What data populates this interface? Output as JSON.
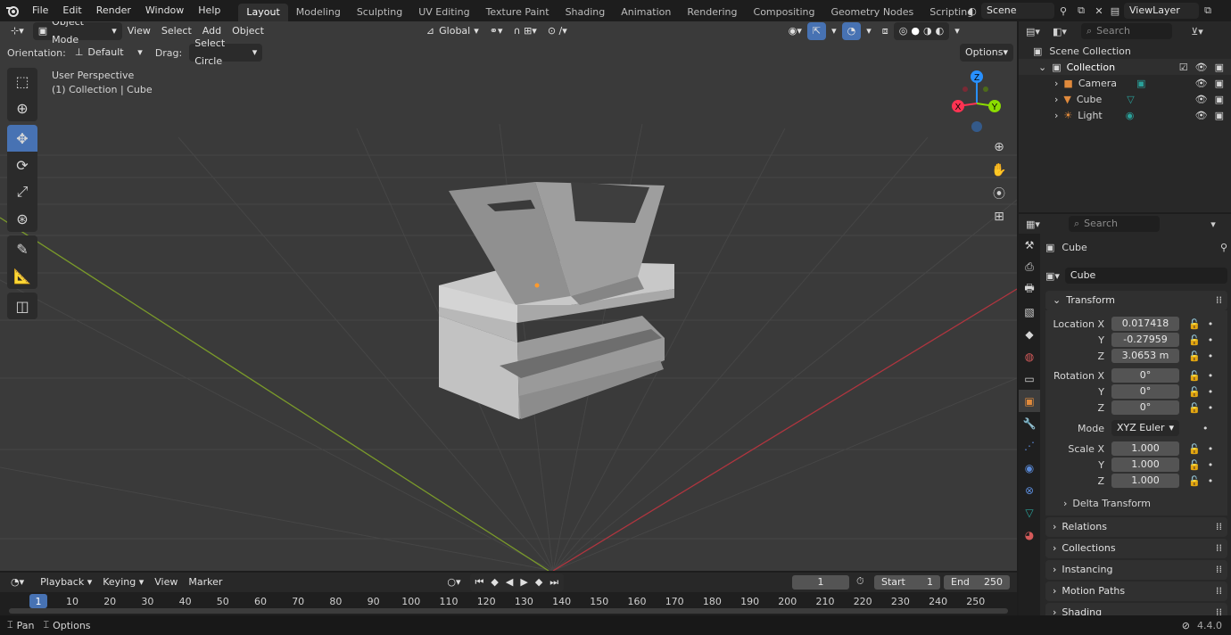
{
  "topbar": {
    "menu": [
      "File",
      "Edit",
      "Render",
      "Window",
      "Help"
    ],
    "workspaces": [
      "Layout",
      "Modeling",
      "Sculpting",
      "UV Editing",
      "Texture Paint",
      "Shading",
      "Animation",
      "Rendering",
      "Compositing",
      "Geometry Nodes",
      "Scripting"
    ],
    "active_workspace": "Layout",
    "scene": "Scene",
    "view_layer": "ViewLayer"
  },
  "viewport": {
    "mode": "Object Mode",
    "menu": [
      "View",
      "Select",
      "Add",
      "Object"
    ],
    "transform_orientation": "Global",
    "orientation_label": "Orientation:",
    "orientation_value": "Default",
    "drag_label": "Drag:",
    "drag_value": "Select Circle",
    "options": "Options",
    "overlay_title": "User Perspective",
    "overlay_subtitle": "(1) Collection | Cube",
    "gizmo": {
      "x": "X",
      "y": "Y",
      "z": "Z"
    }
  },
  "outliner": {
    "search_placeholder": "Search",
    "root": "Scene Collection",
    "collection": "Collection",
    "items": [
      "Camera",
      "Cube",
      "Light"
    ]
  },
  "properties": {
    "search_placeholder": "Search",
    "object_name": "Cube",
    "datablock_name": "Cube",
    "transform_header": "Transform",
    "location_label": "Location X",
    "location": [
      "0.017418",
      "-0.27959",
      "3.0653 m"
    ],
    "rotation_label": "Rotation X",
    "rotation": [
      "0°",
      "0°",
      "0°"
    ],
    "mode_label": "Mode",
    "mode_value": "XYZ Euler",
    "scale_label": "Scale X",
    "scale": [
      "1.000",
      "1.000",
      "1.000"
    ],
    "axis_y": "Y",
    "axis_z": "Z",
    "delta_transform": "Delta Transform",
    "panels": [
      "Relations",
      "Collections",
      "Instancing",
      "Motion Paths",
      "Shading"
    ]
  },
  "timeline": {
    "menu": [
      "Playback",
      "Keying",
      "View",
      "Marker"
    ],
    "current_frame": "1",
    "start_label": "Start",
    "start": "1",
    "end_label": "End",
    "end": "250",
    "ticks": [
      "1",
      "10",
      "20",
      "30",
      "40",
      "50",
      "60",
      "70",
      "80",
      "90",
      "100",
      "110",
      "120",
      "130",
      "140",
      "150",
      "160",
      "170",
      "180",
      "190",
      "200",
      "210",
      "220",
      "230",
      "240",
      "250"
    ]
  },
  "statusbar": {
    "pan": "Pan",
    "options": "Options",
    "version": "4.4.0"
  },
  "colors": {
    "accent": "#4772b3",
    "x_axis": "#ff3352",
    "y_axis": "#8bdc00",
    "z_axis": "#2890ff"
  }
}
